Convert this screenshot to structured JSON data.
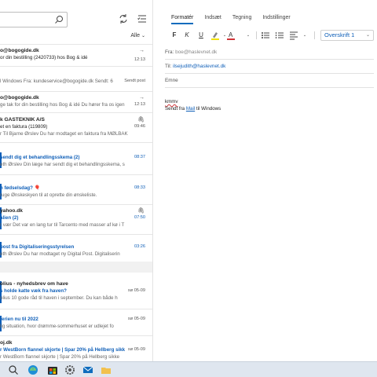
{
  "search": {
    "placeholder": ""
  },
  "list": {
    "filter_label": "Alle",
    "messages": [
      {
        "sender": "o@bogogide.dk",
        "subject": "or din bestilling (2420733) hos Bog & idé",
        "preview": "",
        "time": "12:13"
      },
      {
        "sender": "",
        "subject": "",
        "preview": "l Windows Fra: kundeservice@bogogide.dk Sendt: 6",
        "time": "Sendt post"
      },
      {
        "sender": "o@bogogide.dk",
        "subject": "",
        "preview": "ge tak for din bestilling hos Bog & idé Du hører fra os igen",
        "time": "12:13"
      },
      {
        "sender": "k GASTEKNIK A/S",
        "subject": "et en faktura (119809)",
        "preview": "r Til Bjarne Ørslev Du har modtaget en faktura fra MØLBAK",
        "time": "09:46"
      },
      {
        "sender": "",
        "subject": "sendt dig et behandlingsskema  (2)",
        "preview": "eth Ørslev Din læge har sendt dig et behandlingsskema, s",
        "time": "08:37"
      },
      {
        "sender": "",
        "subject": "n fødselsdag?",
        "preview": "ruge Ønskeskyen til at oprette din ønskeliste.",
        "time": "08:33"
      },
      {
        "sender": "yahoo.dk",
        "subject": "alien  (2)",
        "preview": "r vær  Det var en lang tur til Tarcento med masser af kø i T",
        "time": "07:50"
      },
      {
        "sender": "",
        "subject": "post fra Digitaliseringsstyrelsen",
        "preview": "eth Ørslev Du har modtaget ny Digital Post. Digitaliserin",
        "time": "03:26"
      },
      {
        "sender": "olius - nyhedsbrev om have",
        "subject": "s holde katte væk fra haven?",
        "preview": "olius 10 gode råd til haven i september. Du kan både h",
        "time": "sø 05-09"
      },
      {
        "sender": "",
        "subject": "ferien nu til 2022",
        "preview": "lig situation, hvor drømme-sommerhuset er udlejet fo",
        "time": "sø 05-09"
      },
      {
        "sender": "oj.dk",
        "subject": "r WestBorn flannel skjorte | Spar 20% på Hellberg sikk",
        "preview": "r WestBorn flannel skjorte | Spar 20% på Hellberg sikke",
        "time": "sø 05-09"
      }
    ]
  },
  "compose": {
    "tabs": [
      "Formatér",
      "Indsæt",
      "Tegning",
      "Indstillinger"
    ],
    "style_value": "Overskrift 1",
    "from_label": "Fra:",
    "from_value": "boe@haslevnet.dk",
    "to_label": "Til:",
    "to_value": "ilsejudith@haslevnet.dk",
    "subject_placeholder": "Emne",
    "body_word": "kmmv",
    "signature_prefix": "Sendt fra ",
    "signature_link": "Mail",
    "signature_suffix": " til Windows"
  },
  "colors": {
    "accent": "#0f6cbd",
    "unread": "#0f5fb8"
  }
}
